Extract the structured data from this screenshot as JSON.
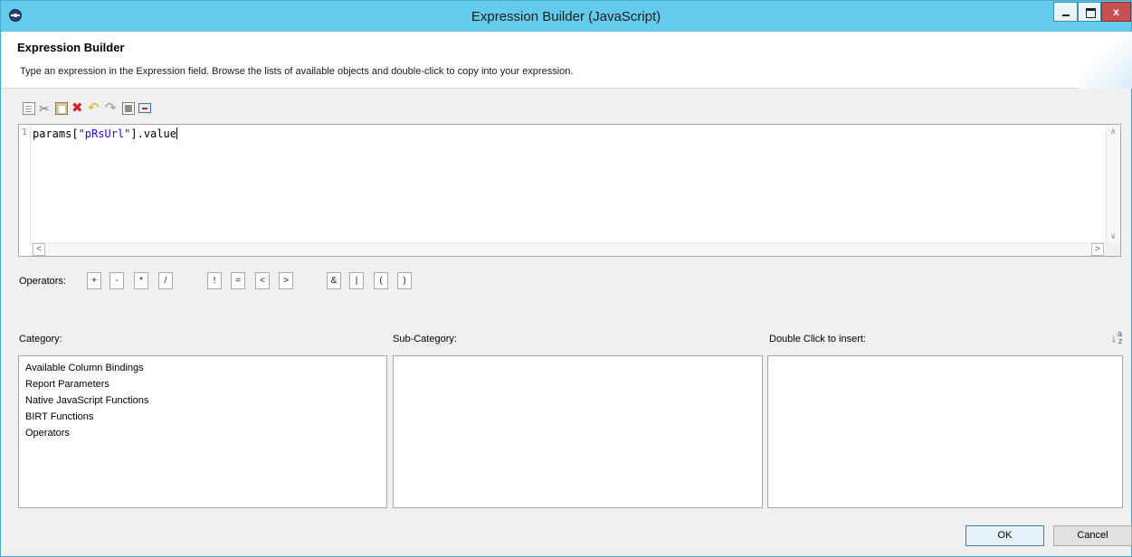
{
  "window": {
    "title": "Expression Builder (JavaScript)",
    "controls": {
      "close_label": "x"
    }
  },
  "header": {
    "title": "Expression Builder",
    "description": "Type an expression in the Expression field. Browse the lists of available objects and double-click to copy into your expression."
  },
  "toolbar": {
    "icons": [
      "copy-icon",
      "cut-icon",
      "paste-icon",
      "delete-icon",
      "undo-icon",
      "redo-icon",
      "select-all-icon",
      "format-icon"
    ]
  },
  "editor": {
    "line_number": "1",
    "code_before": "params[",
    "code_string": "\"pRsUrl\"",
    "code_after": "].value"
  },
  "operators": {
    "label": "Operators:",
    "buttons": [
      "+",
      "-",
      "*",
      "/",
      "!",
      "=",
      "<",
      ">",
      "&",
      "|",
      "(",
      ")"
    ]
  },
  "lists": {
    "category_label": "Category:",
    "subcategory_label": "Sub-Category:",
    "insert_label": "Double Click to insert:",
    "categories": [
      "Available Column Bindings",
      "Report Parameters",
      "Native JavaScript Functions",
      "BIRT Functions",
      "Operators"
    ]
  },
  "buttons": {
    "ok": "OK",
    "cancel": "Cancel"
  }
}
